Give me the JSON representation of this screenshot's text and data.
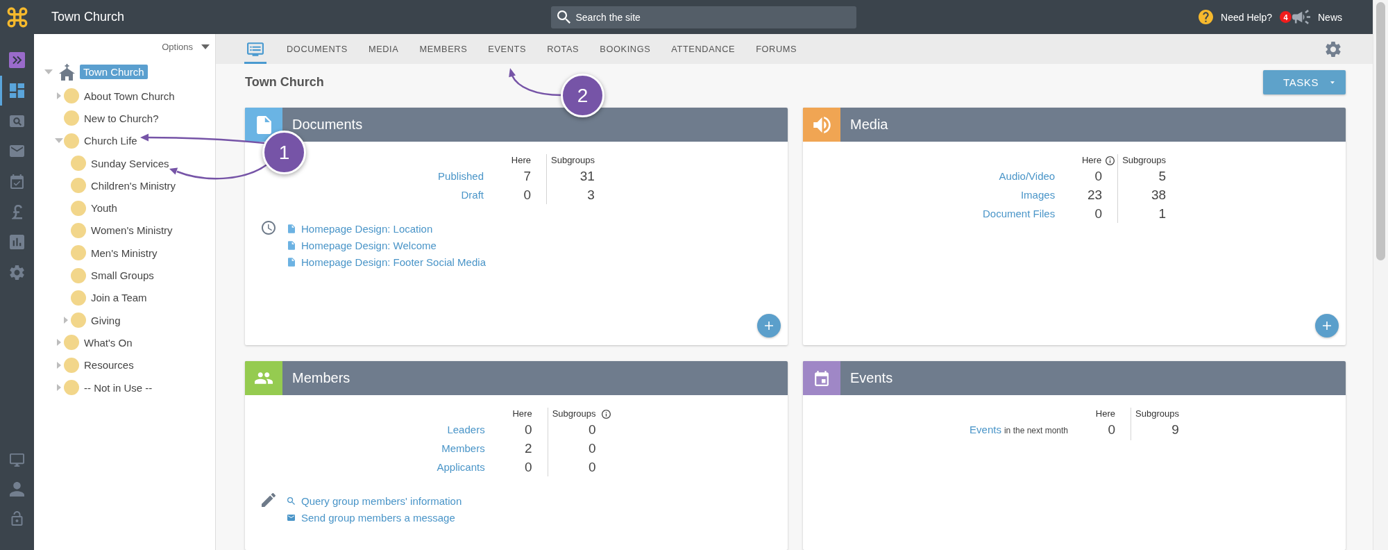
{
  "topbar": {
    "title": "Town Church",
    "search": {
      "placeholder": "Search the site"
    },
    "help": "Need Help?",
    "news": {
      "badge": "4",
      "label": "News"
    }
  },
  "rail": {
    "items": [
      {
        "kind": "expand",
        "selected": false
      },
      {
        "kind": "dashboard",
        "selected": true
      },
      {
        "kind": "search",
        "selected": false
      },
      {
        "kind": "mail",
        "selected": false
      },
      {
        "kind": "calendar",
        "selected": false
      },
      {
        "kind": "finance",
        "selected": false
      },
      {
        "kind": "reports",
        "selected": false
      },
      {
        "kind": "settings",
        "selected": false
      }
    ],
    "bottom": [
      {
        "kind": "display"
      },
      {
        "kind": "account"
      },
      {
        "kind": "lock"
      }
    ]
  },
  "sidebar": {
    "options": "Options",
    "tree": [
      {
        "kind": "root",
        "label": "Town Church",
        "selected": true,
        "expanded": true,
        "children": [
          {
            "kind": "branch",
            "label": "About Town Church",
            "selected": false,
            "expanded": false
          },
          {
            "kind": "leaf",
            "label": "New to Church?",
            "selected": false
          },
          {
            "kind": "branch",
            "label": "Church Life",
            "selected": false,
            "expanded": true,
            "children": [
              {
                "kind": "leaf",
                "label": "Sunday Services",
                "selected": false
              },
              {
                "kind": "leaf",
                "label": "Children's Ministry",
                "selected": false
              },
              {
                "kind": "leaf",
                "label": "Youth",
                "selected": false
              },
              {
                "kind": "leaf",
                "label": "Women's Ministry",
                "selected": false
              },
              {
                "kind": "leaf",
                "label": "Men's Ministry",
                "selected": false
              },
              {
                "kind": "leaf",
                "label": "Small Groups",
                "selected": false
              },
              {
                "kind": "leaf",
                "label": "Join a Team",
                "selected": false
              },
              {
                "kind": "branch",
                "label": "Giving",
                "selected": false,
                "expanded": false
              }
            ]
          },
          {
            "kind": "branch",
            "label": "What's On",
            "selected": false,
            "expanded": false
          },
          {
            "kind": "branch",
            "label": "Resources",
            "selected": false,
            "expanded": false
          },
          {
            "kind": "branch",
            "label": "-- Not in Use --",
            "selected": false,
            "expanded": false
          }
        ]
      }
    ]
  },
  "tabs": [
    {
      "kind": "icon",
      "selected": true
    },
    {
      "kind": "text",
      "label": "DOCUMENTS",
      "selected": false
    },
    {
      "kind": "text",
      "label": "MEDIA",
      "selected": false
    },
    {
      "kind": "text",
      "label": "MEMBERS",
      "selected": false
    },
    {
      "kind": "text",
      "label": "EVENTS",
      "selected": false
    },
    {
      "kind": "text",
      "label": "ROTAS",
      "selected": false
    },
    {
      "kind": "text",
      "label": "BOOKINGS",
      "selected": false
    },
    {
      "kind": "text",
      "label": "ATTENDANCE",
      "selected": false
    },
    {
      "kind": "text",
      "label": "FORUMS",
      "selected": false
    }
  ],
  "page": {
    "title": "Town Church",
    "tasks_button": "TASKS"
  },
  "cards": [
    {
      "kind": "documents",
      "title": "Documents",
      "color": "#6ab4e4",
      "columns": [
        {
          "label": "Here",
          "info": false
        },
        {
          "label": "Subgroups",
          "info": false
        }
      ],
      "rows": [
        {
          "label": "Published",
          "here": "7",
          "subgroups": "31"
        },
        {
          "label": "Draft",
          "here": "0",
          "subgroups": "3"
        }
      ],
      "links": {
        "kind": "recent",
        "items": [
          {
            "kind": "document",
            "label": "Homepage Design: Location"
          },
          {
            "kind": "document",
            "label": "Homepage Design: Welcome"
          },
          {
            "kind": "document",
            "label": "Homepage Design: Footer Social Media"
          }
        ]
      },
      "add_button": true
    },
    {
      "kind": "media",
      "title": "Media",
      "color": "#f0a553",
      "columns": [
        {
          "label": "Here",
          "info": true
        },
        {
          "label": "Subgroups",
          "info": false
        }
      ],
      "rows": [
        {
          "label": "Audio/Video",
          "here": "0",
          "subgroups": "5"
        },
        {
          "label": "Images",
          "here": "23",
          "subgroups": "38"
        },
        {
          "label": "Document Files",
          "here": "0",
          "subgroups": "1"
        }
      ],
      "add_button": true
    },
    {
      "kind": "members",
      "title": "Members",
      "color": "#95cb50",
      "columns": [
        {
          "label": "Here",
          "info": false
        },
        {
          "label": "Subgroups",
          "info": true
        }
      ],
      "rows": [
        {
          "label": "Leaders",
          "here": "0",
          "subgroups": "0"
        },
        {
          "label": "Members",
          "here": "2",
          "subgroups": "0"
        },
        {
          "label": "Applicants",
          "here": "0",
          "subgroups": "0"
        }
      ],
      "links": {
        "kind": "actions",
        "items": [
          {
            "kind": "query",
            "label": "Query group members' information"
          },
          {
            "kind": "message",
            "label": "Send group members a message"
          }
        ]
      },
      "add_button": false
    },
    {
      "kind": "events",
      "title": "Events",
      "color": "#9f87c6",
      "columns": [
        {
          "label": "Here",
          "info": false
        },
        {
          "label": "Subgroups",
          "info": false
        }
      ],
      "rows": [
        {
          "label": "Events",
          "note": "in the next month",
          "here": "0",
          "subgroups": "9"
        }
      ],
      "add_button": false
    }
  ],
  "callouts": [
    {
      "label": "1"
    },
    {
      "label": "2"
    }
  ]
}
